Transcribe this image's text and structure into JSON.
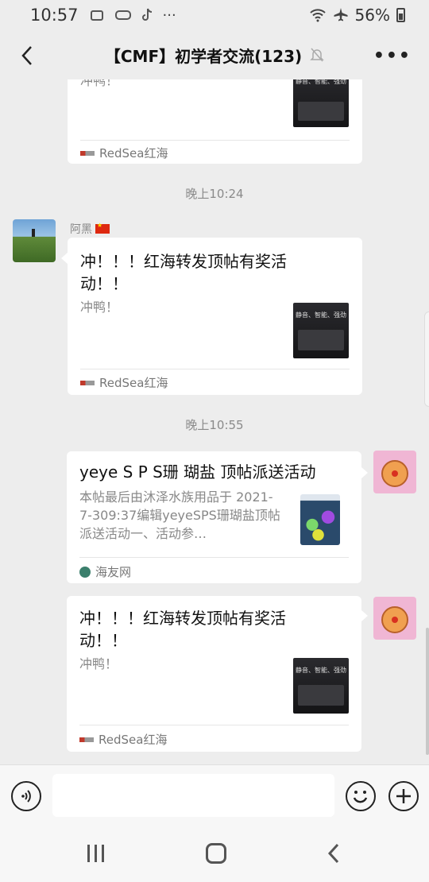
{
  "status_bar": {
    "time": "10:57",
    "battery": "56%"
  },
  "header": {
    "title": "【CMF】初学者交流(123)"
  },
  "messages": {
    "card0": {
      "desc": "冲鸭！",
      "source": "RedSea红海",
      "thumb_text": "静音、智能、强劲"
    },
    "ts1": "晚上10:24",
    "msg1": {
      "sender": "阿黑",
      "title": "冲！！！红海转发顶帖有奖活动！！",
      "desc": "冲鸭！",
      "source": "RedSea红海",
      "thumb_text": "静音、智能、强劲"
    },
    "ts2": "晚上10:55",
    "msg2": {
      "title": "yeye S P S珊 瑚盐 顶帖派送活动",
      "desc": "本帖最后由沐泽水族用品于 2021-7-309:37编辑yeyeSPS珊瑚盐顶帖派送活动一、活动参…",
      "source": "海友网"
    },
    "msg3": {
      "title": "冲！！！红海转发顶帖有奖活动！！",
      "desc": "冲鸭！",
      "source": "RedSea红海",
      "thumb_text": "静音、智能、强劲"
    }
  },
  "input": {
    "placeholder": ""
  },
  "colors": {
    "background": "#ededed",
    "card": "#ffffff",
    "muted": "#888888"
  }
}
